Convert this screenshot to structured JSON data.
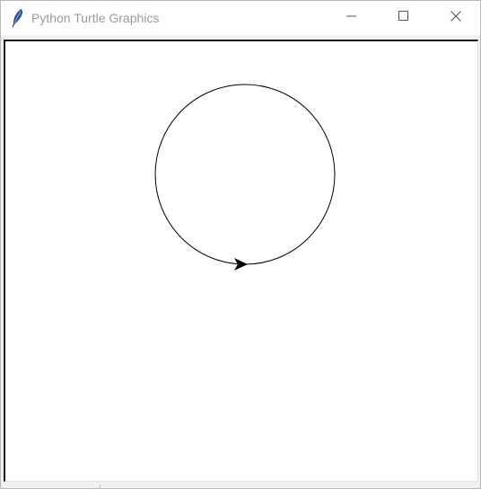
{
  "window": {
    "title": "Python Turtle Graphics",
    "icon": "feather-icon",
    "controls": {
      "minimize_icon": "minimize-icon",
      "maximize_icon": "maximize-icon",
      "close_icon": "close-icon"
    }
  },
  "canvas": {
    "background": "#ffffff",
    "pen_color": "#000000",
    "drawing": {
      "shape": "circle",
      "turtle_shape": "classic-arrow",
      "turtle_heading": "east"
    }
  }
}
